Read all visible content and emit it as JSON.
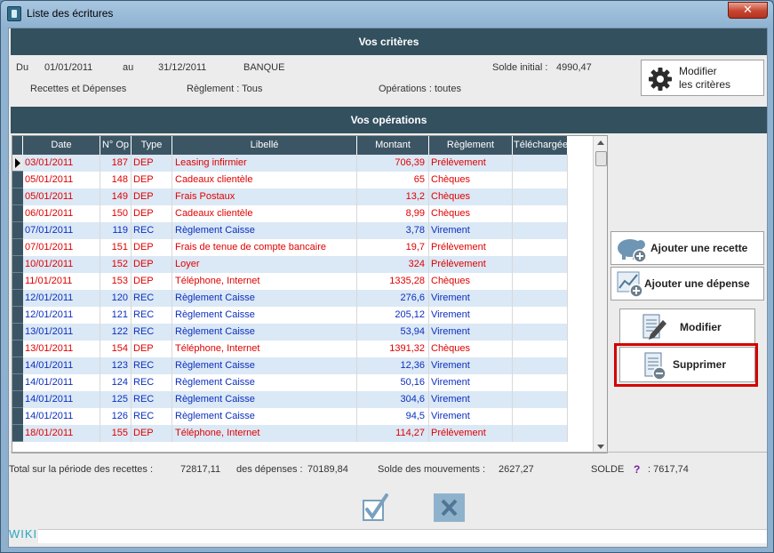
{
  "window": {
    "title": "Liste des écritures",
    "close_glyph": "✕"
  },
  "criteria": {
    "header": "Vos critères",
    "du_label": "Du",
    "du_value": "01/01/2011",
    "au_label": "au",
    "au_value": "31/12/2011",
    "account": "BANQUE",
    "solde_initial_label": "Solde initial :",
    "solde_initial_value": "4990,47",
    "type": "Recettes et Dépenses",
    "reglement": "Règlement : Tous",
    "operations": "Opérations : toutes",
    "modify_button_line1": "Modifier",
    "modify_button_line2": "les critères"
  },
  "operations": {
    "header": "Vos opérations",
    "columns": [
      "Date",
      "N° Op",
      "Type",
      "Libellé",
      "Montant",
      "Règlement",
      "Téléchargée"
    ],
    "rows": [
      [
        "03/01/2011",
        "187",
        "DEP",
        "Leasing infirmier",
        "706,39",
        "Prélèvement",
        ""
      ],
      [
        "05/01/2011",
        "148",
        "DEP",
        "Cadeaux clientèle",
        "65",
        "Chèques",
        ""
      ],
      [
        "05/01/2011",
        "149",
        "DEP",
        "Frais Postaux",
        "13,2",
        "Chèques",
        ""
      ],
      [
        "06/01/2011",
        "150",
        "DEP",
        "Cadeaux clientèle",
        "8,99",
        "Chèques",
        ""
      ],
      [
        "07/01/2011",
        "119",
        "REC",
        "Règlement Caisse",
        "3,78",
        "Virement",
        ""
      ],
      [
        "07/01/2011",
        "151",
        "DEP",
        "Frais de tenue de compte bancaire",
        "19,7",
        "Prélèvement",
        ""
      ],
      [
        "10/01/2011",
        "152",
        "DEP",
        "Loyer",
        "324",
        "Prélèvement",
        ""
      ],
      [
        "11/01/2011",
        "153",
        "DEP",
        "Téléphone, Internet",
        "1335,28",
        "Chèques",
        ""
      ],
      [
        "12/01/2011",
        "120",
        "REC",
        "Règlement Caisse",
        "276,6",
        "Virement",
        ""
      ],
      [
        "12/01/2011",
        "121",
        "REC",
        "Règlement Caisse",
        "205,12",
        "Virement",
        ""
      ],
      [
        "13/01/2011",
        "122",
        "REC",
        "Règlement Caisse",
        "53,94",
        "Virement",
        ""
      ],
      [
        "13/01/2011",
        "154",
        "DEP",
        "Téléphone, Internet",
        "1391,32",
        "Chèques",
        ""
      ],
      [
        "14/01/2011",
        "123",
        "REC",
        "Règlement Caisse",
        "12,36",
        "Virement",
        ""
      ],
      [
        "14/01/2011",
        "124",
        "REC",
        "Règlement Caisse",
        "50,16",
        "Virement",
        ""
      ],
      [
        "14/01/2011",
        "125",
        "REC",
        "Règlement Caisse",
        "304,6",
        "Virement",
        ""
      ],
      [
        "14/01/2011",
        "126",
        "REC",
        "Règlement Caisse",
        "94,5",
        "Virement",
        ""
      ],
      [
        "18/01/2011",
        "155",
        "DEP",
        "Téléphone, Internet",
        "114,27",
        "Prélèvement",
        ""
      ]
    ]
  },
  "actions": {
    "add_income": "Ajouter une recette",
    "add_expense": "Ajouter une dépense",
    "modify": "Modifier",
    "delete": "Supprimer"
  },
  "totals": {
    "recettes_label": "Total sur la période des recettes :",
    "recettes_value": "72817,11",
    "depenses_label": "des dépenses :",
    "depenses_value": "70189,84",
    "mouvements_label": "Solde des mouvements :",
    "mouvements_value": "2627,27",
    "solde_label": "SOLDE",
    "help_glyph": "?",
    "solde_value": ": 7617,74"
  },
  "bottom": {
    "wiki": "WIKI"
  },
  "colors": {
    "dep": "#e00000",
    "rec": "#0b2fbf",
    "row_alt": "#dbe8f5",
    "header": "#33505f",
    "highlight": "#d40000"
  }
}
